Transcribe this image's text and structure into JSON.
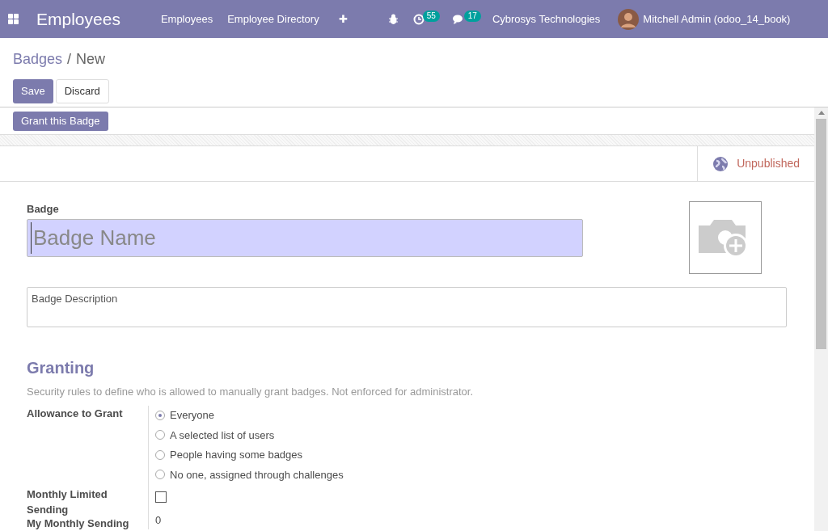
{
  "navbar": {
    "app_title": "Employees",
    "menu": [
      "Employees",
      "Employee Directory"
    ],
    "plus": "✚",
    "activity_count": "55",
    "message_count": "17",
    "company": "Cybrosys Technologies",
    "user": "Mitchell Admin (odoo_14_book)"
  },
  "breadcrumb": {
    "parent": "Badges",
    "separator": "/",
    "current": "New"
  },
  "buttons": {
    "save": "Save",
    "discard": "Discard"
  },
  "header_button": "Grant this Badge",
  "publish": {
    "label": "Unpublished",
    "published": false
  },
  "form": {
    "badge_label": "Badge",
    "name_placeholder": "Badge Name",
    "description_placeholder": "Badge Description",
    "section_title": "Granting",
    "section_help": "Security rules to define who is allowed to manually grant badges. Not enforced for administrator.",
    "allowance_label": "Allowance to Grant",
    "allowance_options": [
      {
        "label": "Everyone",
        "selected": true
      },
      {
        "label": "A selected list of users",
        "selected": false
      },
      {
        "label": "People having some badges",
        "selected": false
      },
      {
        "label": "No one, assigned through challenges",
        "selected": false
      }
    ],
    "monthly_label": "Monthly Limited Sending",
    "monthly_checked": false,
    "my_sending_label": "My Monthly Sending",
    "my_sending_value": "0"
  }
}
